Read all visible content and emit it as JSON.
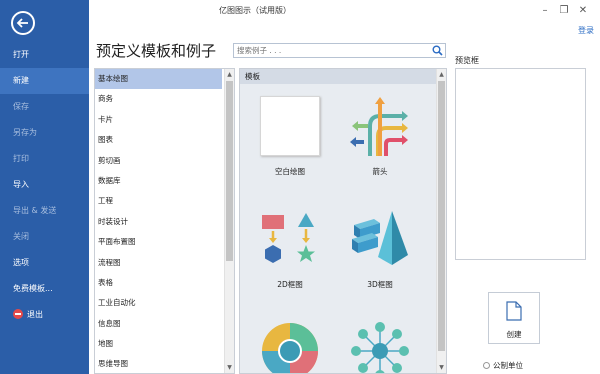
{
  "window": {
    "title": "亿图图示（试用版）",
    "minimize": "–",
    "restore": "❐",
    "close": "✕",
    "login": "登录"
  },
  "sidebar": {
    "items": [
      {
        "label": "打开",
        "state": "normal"
      },
      {
        "label": "新建",
        "state": "active"
      },
      {
        "label": "保存",
        "state": "disabled"
      },
      {
        "label": "另存为",
        "state": "disabled"
      },
      {
        "label": "打印",
        "state": "disabled"
      },
      {
        "label": "导入",
        "state": "normal"
      },
      {
        "label": "导出 & 发送",
        "state": "disabled"
      },
      {
        "label": "关闭",
        "state": "disabled"
      },
      {
        "label": "选项",
        "state": "normal"
      },
      {
        "label": "免费模板...",
        "state": "normal"
      },
      {
        "label": "退出",
        "state": "normal"
      }
    ]
  },
  "main": {
    "heading": "预定义模板和例子",
    "search_placeholder": "搜索例子 . . .",
    "categories": [
      "基本绘图",
      "商务",
      "卡片",
      "图表",
      "剪切画",
      "数据库",
      "工程",
      "时装设计",
      "平面布置图",
      "流程图",
      "表格",
      "工业自动化",
      "信息图",
      "地图",
      "思维导图"
    ],
    "selected_category": "基本绘图",
    "templates_header": "模板",
    "templates": [
      {
        "label": "空白绘图",
        "icon": "blank-page-icon"
      },
      {
        "label": "箭头",
        "icon": "arrows-icon"
      },
      {
        "label": "2D框图",
        "icon": "2d-shapes-icon"
      },
      {
        "label": "3D框图",
        "icon": "3d-shapes-icon"
      },
      {
        "label": "",
        "icon": "circle-diagram-icon"
      },
      {
        "label": "",
        "icon": "network-diagram-icon"
      }
    ]
  },
  "right": {
    "preview_label": "预览框",
    "create_label": "创建",
    "unit_label": "公制单位"
  },
  "colors": {
    "sidebar_bg": "#2b5ea8",
    "sidebar_active": "#3e74c0",
    "selection": "#b2c6e8",
    "link": "#2b6cc4"
  }
}
